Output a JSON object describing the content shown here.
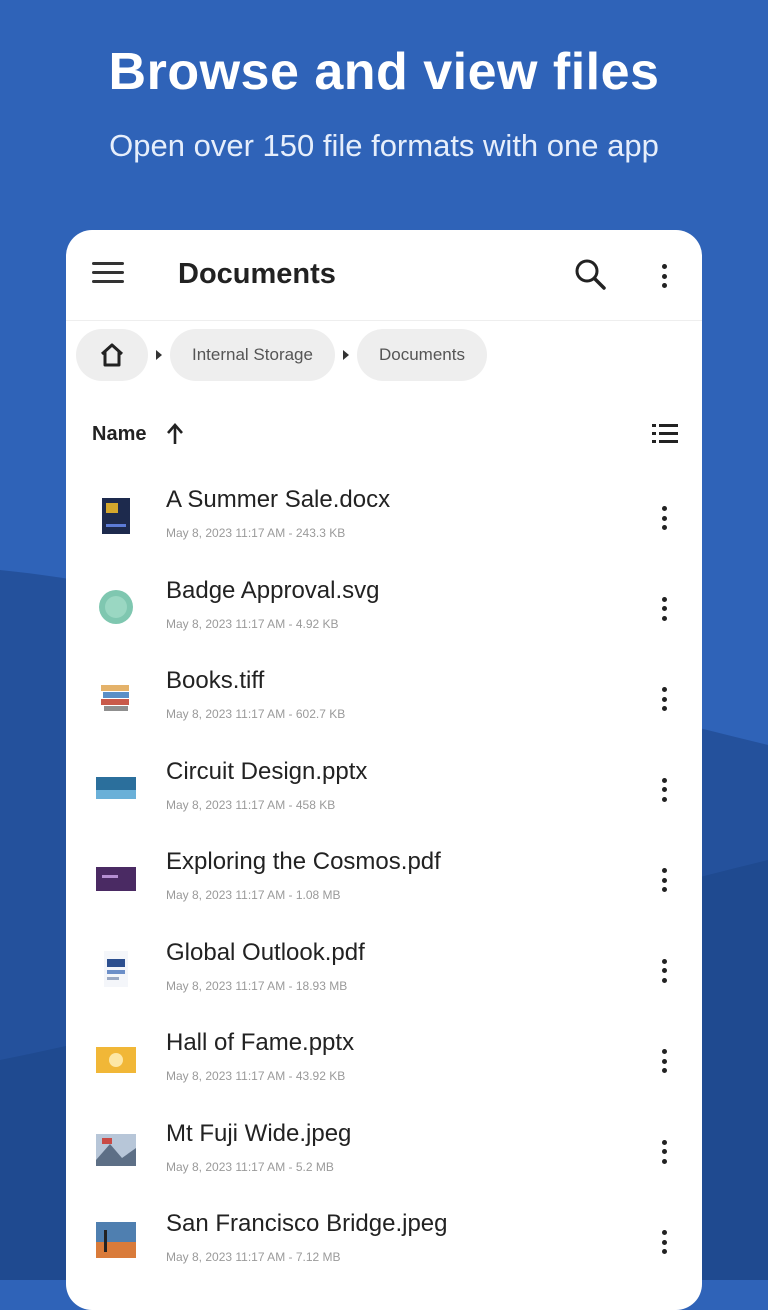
{
  "promo": {
    "title": "Browse and view files",
    "subtitle": "Open over 150 file formats with one app"
  },
  "colors": {
    "background": "#2f63b8",
    "wave_dark": "#24519c",
    "wave_darker": "#1f4a90",
    "card": "#ffffff"
  },
  "appbar": {
    "title": "Documents",
    "icons": [
      "menu-icon",
      "search-icon",
      "more-vert-icon"
    ]
  },
  "breadcrumb": {
    "home_icon": "home-icon",
    "items": [
      "Internal Storage",
      "Documents"
    ]
  },
  "sort": {
    "label": "Name",
    "direction_icon": "arrow-up-icon",
    "view_icon": "list-view-icon"
  },
  "files": [
    {
      "name": "A Summer Sale.docx",
      "meta": "May 8, 2023 11:17 AM - 243.3 KB",
      "thumb": "docx-thumb"
    },
    {
      "name": "Badge Approval.svg",
      "meta": "May 8, 2023 11:17 AM - 4.92 KB",
      "thumb": "svg-thumb"
    },
    {
      "name": "Books.tiff",
      "meta": "May 8, 2023 11:17 AM - 602.7 KB",
      "thumb": "tiff-thumb"
    },
    {
      "name": "Circuit Design.pptx",
      "meta": "May 8, 2023 11:17 AM - 458 KB",
      "thumb": "pptx-thumb"
    },
    {
      "name": "Exploring the Cosmos.pdf",
      "meta": "May 8, 2023 11:17 AM - 1.08 MB",
      "thumb": "pdf-thumb"
    },
    {
      "name": "Global Outlook.pdf",
      "meta": "May 8, 2023 11:17 AM - 18.93 MB",
      "thumb": "pdf-thumb"
    },
    {
      "name": "Hall of Fame.pptx",
      "meta": "May 8, 2023 11:17 AM - 43.92 KB",
      "thumb": "pptx-thumb"
    },
    {
      "name": "Mt Fuji Wide.jpeg",
      "meta": "May 8, 2023 11:17 AM - 5.2 MB",
      "thumb": "jpeg-thumb"
    },
    {
      "name": "San Francisco Bridge.jpeg",
      "meta": "May 8, 2023 11:17 AM - 7.12 MB",
      "thumb": "jpeg-thumb"
    }
  ]
}
